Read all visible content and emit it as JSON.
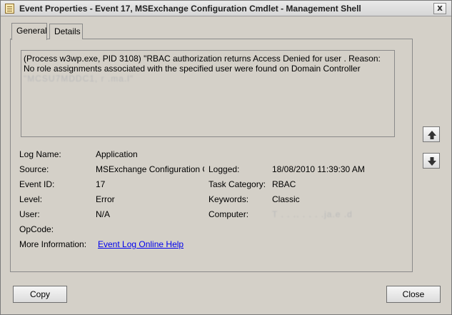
{
  "window": {
    "title": "Event Properties - Event 17, MSExchange Configuration Cmdlet - Management Shell",
    "close_glyph": "x"
  },
  "tabs": [
    {
      "label": "General",
      "active": true
    },
    {
      "label": "Details",
      "active": false
    }
  ],
  "message": {
    "text": "(Process w3wp.exe, PID 3108) \"RBAC authorization returns Access Denied for user . Reason: No role assignments associated with the specified user were found on Domain Controller",
    "redacted_tail": "\"MCSU7MDDC1,  r     .ma.l\""
  },
  "fields": {
    "log_name": {
      "label": "Log Name:",
      "value": "Application"
    },
    "source": {
      "label": "Source:",
      "value": "MSExchange Configuration C"
    },
    "logged": {
      "label": "Logged:",
      "value": "18/08/2010 11:39:30 AM"
    },
    "event_id": {
      "label": "Event ID:",
      "value": "17"
    },
    "task_category": {
      "label": "Task Category:",
      "value": "RBAC"
    },
    "level": {
      "label": "Level:",
      "value": "Error"
    },
    "keywords": {
      "label": "Keywords:",
      "value": "Classic"
    },
    "user": {
      "label": "User:",
      "value": "N/A"
    },
    "computer": {
      "label": "Computer:",
      "value": "T    .  .  ..  .  .  .  .ja.e  .d"
    },
    "opcode": {
      "label": "OpCode:",
      "value": ""
    },
    "more_info": {
      "label": "More Information:",
      "link": "Event Log Online Help"
    }
  },
  "buttons": {
    "copy": "Copy",
    "close": "Close"
  },
  "icons": {
    "up": "arrow-up-icon",
    "down": "arrow-down-icon"
  }
}
